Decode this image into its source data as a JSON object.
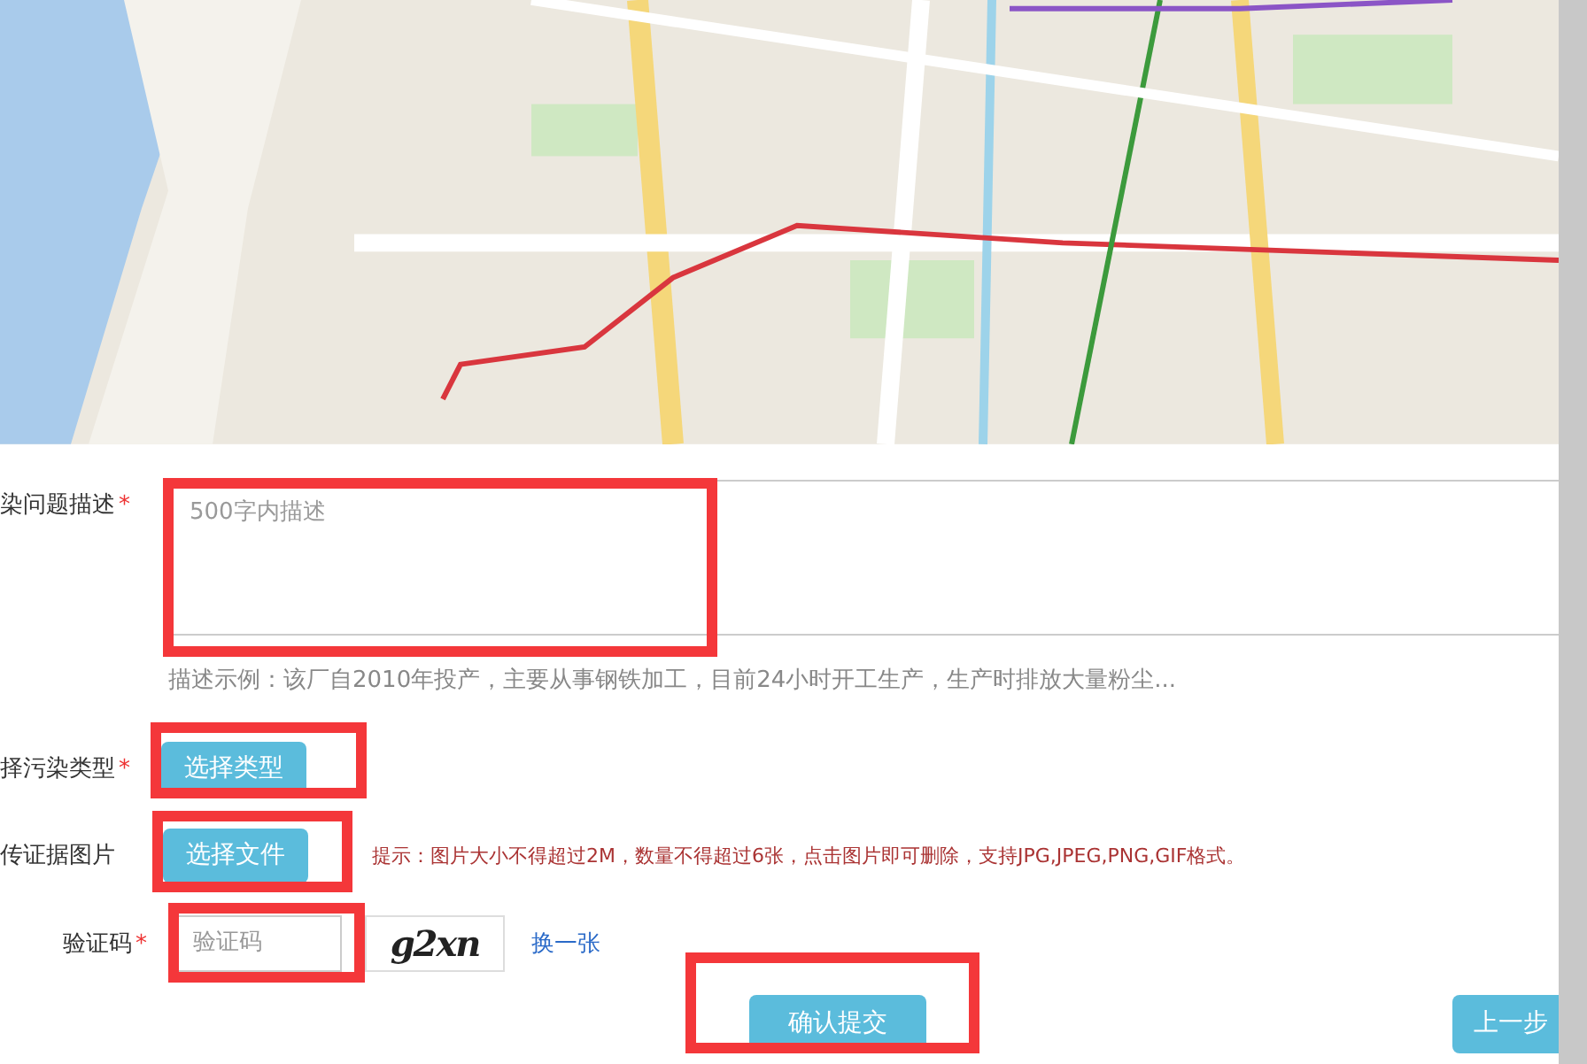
{
  "form": {
    "description": {
      "label": "染问题描述",
      "mark": "*",
      "placeholder": "500字内描述",
      "example": "描述示例：该厂自2010年投产，主要从事钢铁加工，目前24小时开工生产，生产时排放大量粉尘..."
    },
    "type": {
      "label": "择污染类型",
      "mark": "*",
      "button": "选择类型"
    },
    "upload": {
      "label": "传证据图片",
      "button": "选择文件",
      "hint": "提示：图片大小不得超过2M，数量不得超过6张，点击图片即可删除，支持JPG,JPEG,PNG,GIF格式。"
    },
    "captcha": {
      "label": "验证码",
      "mark": "*",
      "placeholder": "验证码",
      "code": "g2xn",
      "refresh": "换一张"
    }
  },
  "buttons": [
    {
      "label": "确认提交",
      "kind": "submit"
    },
    {
      "label": "上一步",
      "kind": "back"
    }
  ]
}
